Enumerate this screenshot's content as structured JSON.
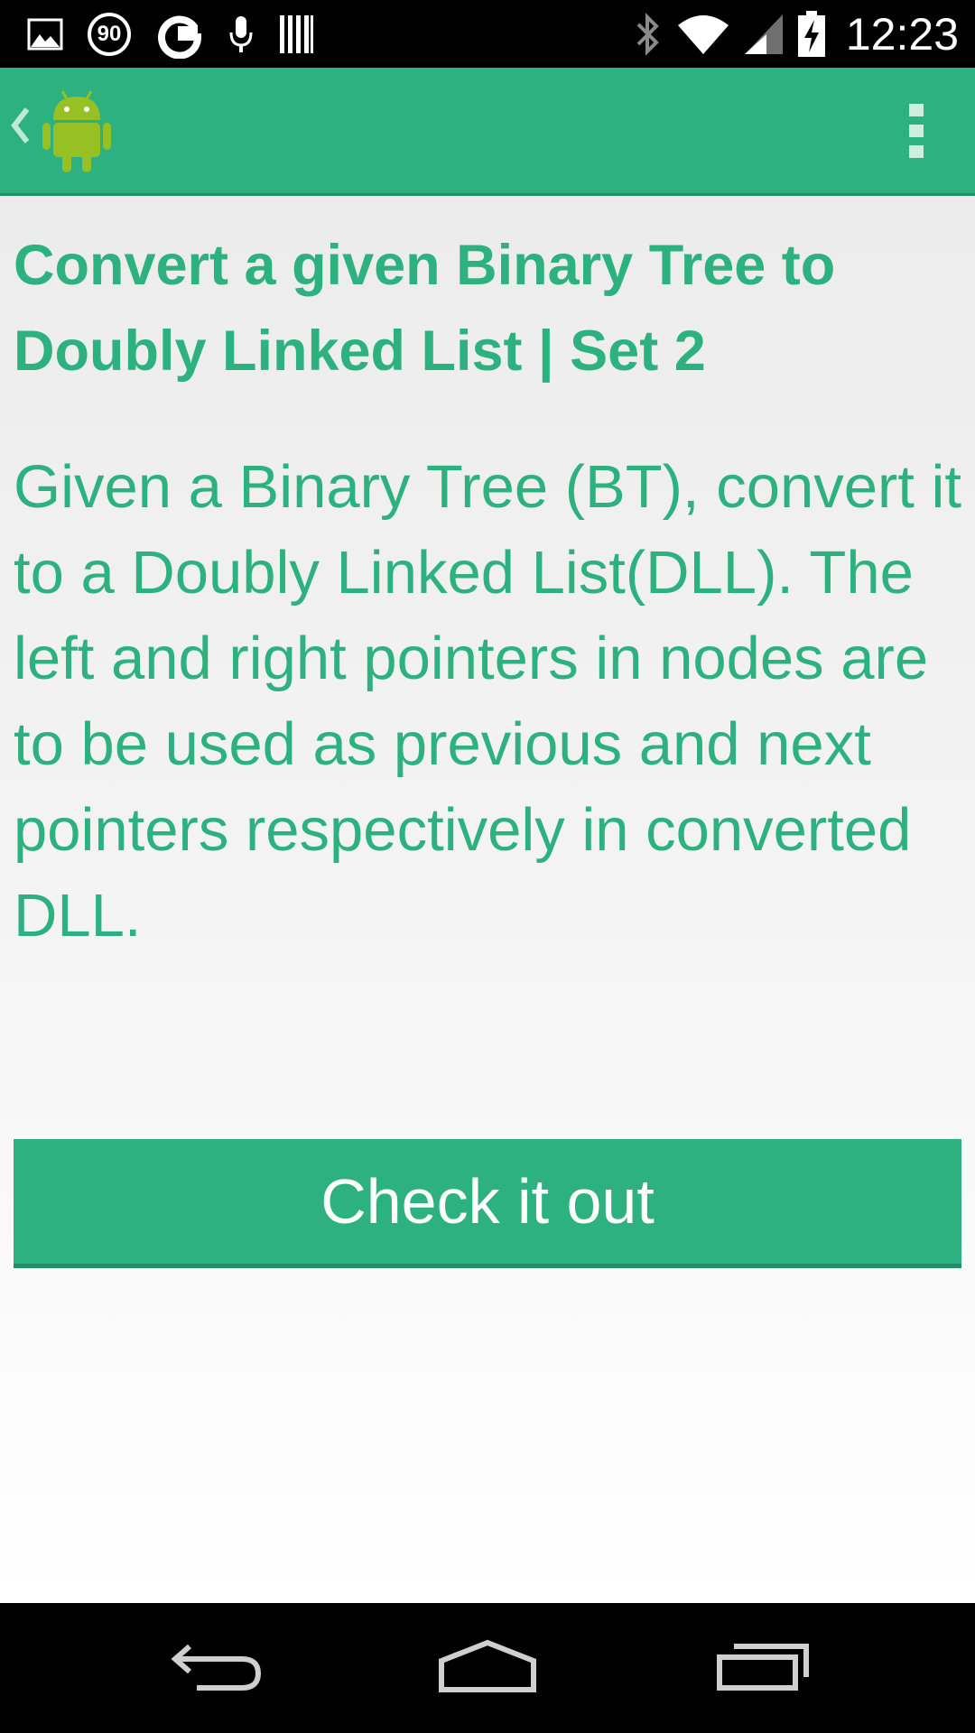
{
  "status_bar": {
    "time": "12:23",
    "notification_badge": "90",
    "left_icons": [
      "gallery-icon",
      "badge-90-icon",
      "google-icon",
      "microphone-icon",
      "barcode-icon"
    ],
    "right_icons": [
      "bluetooth-icon",
      "wifi-icon",
      "cell-signal-icon",
      "battery-charging-icon"
    ]
  },
  "action_bar": {
    "up_icon": "chevron-left-icon",
    "logo_icon": "android-robot-icon",
    "menu_icon": "overflow-menu-icon",
    "color": "#2db180"
  },
  "main": {
    "title": "Convert a given Binary Tree to Doubly Linked List | Set 2",
    "description": "Given a Binary Tree (BT), convert it to a Doubly Linked List(DLL). The left and right pointers in nodes are to be used as previous and next pointers respectively in converted DLL.",
    "button_label": "Check it out"
  },
  "nav_bar": {
    "icons": [
      "back-icon",
      "home-icon",
      "recent-apps-icon"
    ]
  },
  "colors": {
    "accent": "#2db180",
    "accent_dark": "#1f8f66"
  }
}
